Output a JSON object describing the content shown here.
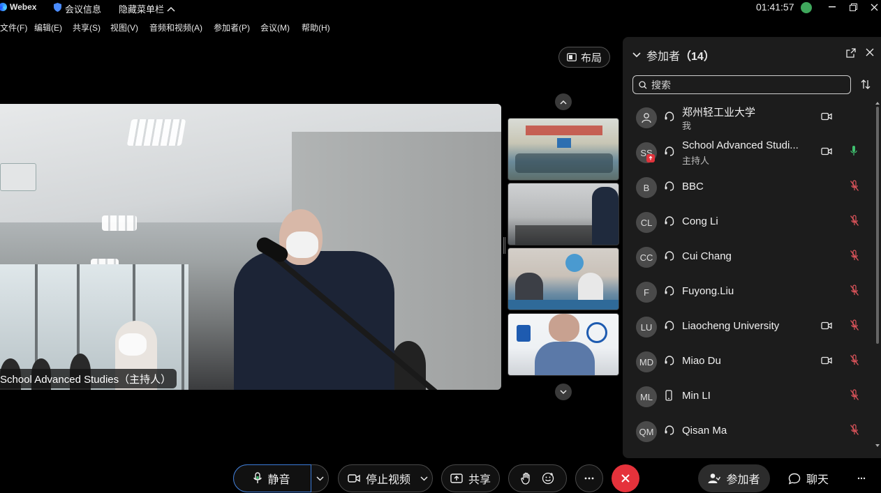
{
  "app": {
    "name": "Webex",
    "meeting_info": "会议信息",
    "hide_menu": "隐藏菜单栏",
    "clock": "01:41:57"
  },
  "menu": [
    "文件(F)",
    "编辑(E)",
    "共享(S)",
    "视图(V)",
    "音频和视频(A)",
    "参加者(P)",
    "会议(M)",
    "帮助(H)"
  ],
  "layout_label": "布局",
  "main_video": {
    "name_label": "School Advanced Studies（主持人）"
  },
  "participants_panel": {
    "title": "参加者",
    "count": "（14）",
    "search_placeholder": "搜索",
    "participants": [
      {
        "initials": "",
        "name": "郑州轻工业大学",
        "sub": "我",
        "connection": "headset",
        "camera": true,
        "mic": "none",
        "host": false
      },
      {
        "initials": "SS",
        "name": "School Advanced Studi...",
        "sub": "主持人",
        "connection": "headset",
        "camera": true,
        "mic": "active",
        "host": true
      },
      {
        "initials": "B",
        "name": "BBC",
        "sub": "",
        "connection": "headset",
        "camera": false,
        "mic": "muted",
        "host": false
      },
      {
        "initials": "CL",
        "name": "Cong Li",
        "sub": "",
        "connection": "headset",
        "camera": false,
        "mic": "muted",
        "host": false
      },
      {
        "initials": "CC",
        "name": "Cui Chang",
        "sub": "",
        "connection": "headset",
        "camera": false,
        "mic": "muted",
        "host": false
      },
      {
        "initials": "F",
        "name": "Fuyong.Liu",
        "sub": "",
        "connection": "headset",
        "camera": false,
        "mic": "muted",
        "host": false
      },
      {
        "initials": "LU",
        "name": "Liaocheng University",
        "sub": "",
        "connection": "headset",
        "camera": true,
        "mic": "muted",
        "host": false
      },
      {
        "initials": "MD",
        "name": "Miao Du",
        "sub": "",
        "connection": "headset",
        "camera": true,
        "mic": "muted",
        "host": false
      },
      {
        "initials": "ML",
        "name": "Min LI",
        "sub": "",
        "connection": "phone",
        "camera": false,
        "mic": "muted",
        "host": false
      },
      {
        "initials": "QM",
        "name": "Qisan Ma",
        "sub": "",
        "connection": "headset",
        "camera": false,
        "mic": "muted",
        "host": false
      }
    ]
  },
  "toolbar": {
    "mute_label": "静音",
    "stop_video_label": "停止视频",
    "share_label": "共享",
    "participants_label": "参加者",
    "chat_label": "聊天"
  },
  "colors": {
    "end_call": "#e5323b",
    "mic_active": "#3fbf6f",
    "mic_muted": "#e0555c",
    "mute_focus": "#3b7bd8"
  }
}
